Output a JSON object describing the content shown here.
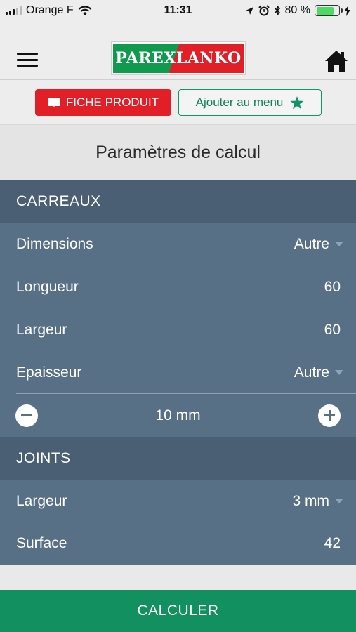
{
  "status_bar": {
    "carrier": "Orange F",
    "time": "11:31",
    "battery_percent": "80 %",
    "battery_level": 0.8,
    "icons": [
      "signal-icon",
      "wifi-icon",
      "location-icon",
      "alarm-icon",
      "bluetooth-icon",
      "battery-icon",
      "charging-icon"
    ]
  },
  "nav": {
    "logo_text": "PAREXLANKO",
    "menu_icon": "hamburger-icon",
    "home_icon": "home-icon"
  },
  "actions": {
    "fiche_label": "FICHE PRODUIT",
    "fiche_icon": "book-icon",
    "menu_label": "Ajouter au menu",
    "menu_icon": "star-icon"
  },
  "page": {
    "title": "Paramètres de calcul"
  },
  "carreaux": {
    "header": "CARREAUX",
    "dimensions_label": "Dimensions",
    "dimensions_value": "Autre",
    "longueur_label": "Longueur",
    "longueur_value": "60",
    "largeur_label": "Largeur",
    "largeur_value": "60",
    "epaisseur_label": "Epaisseur",
    "epaisseur_value": "Autre",
    "stepper_value": "10 mm"
  },
  "joints": {
    "header": "JOINTS",
    "largeur_label": "Largeur",
    "largeur_value": "3 mm",
    "surface_label": "Surface",
    "surface_value": "42"
  },
  "footer": {
    "calculate_label": "CALCULER"
  },
  "colors": {
    "brand_red": "#e21f26",
    "brand_green": "#109a4d",
    "section_header": "#4a5f73",
    "row_bg": "#587085",
    "calc_button": "#13905f"
  }
}
